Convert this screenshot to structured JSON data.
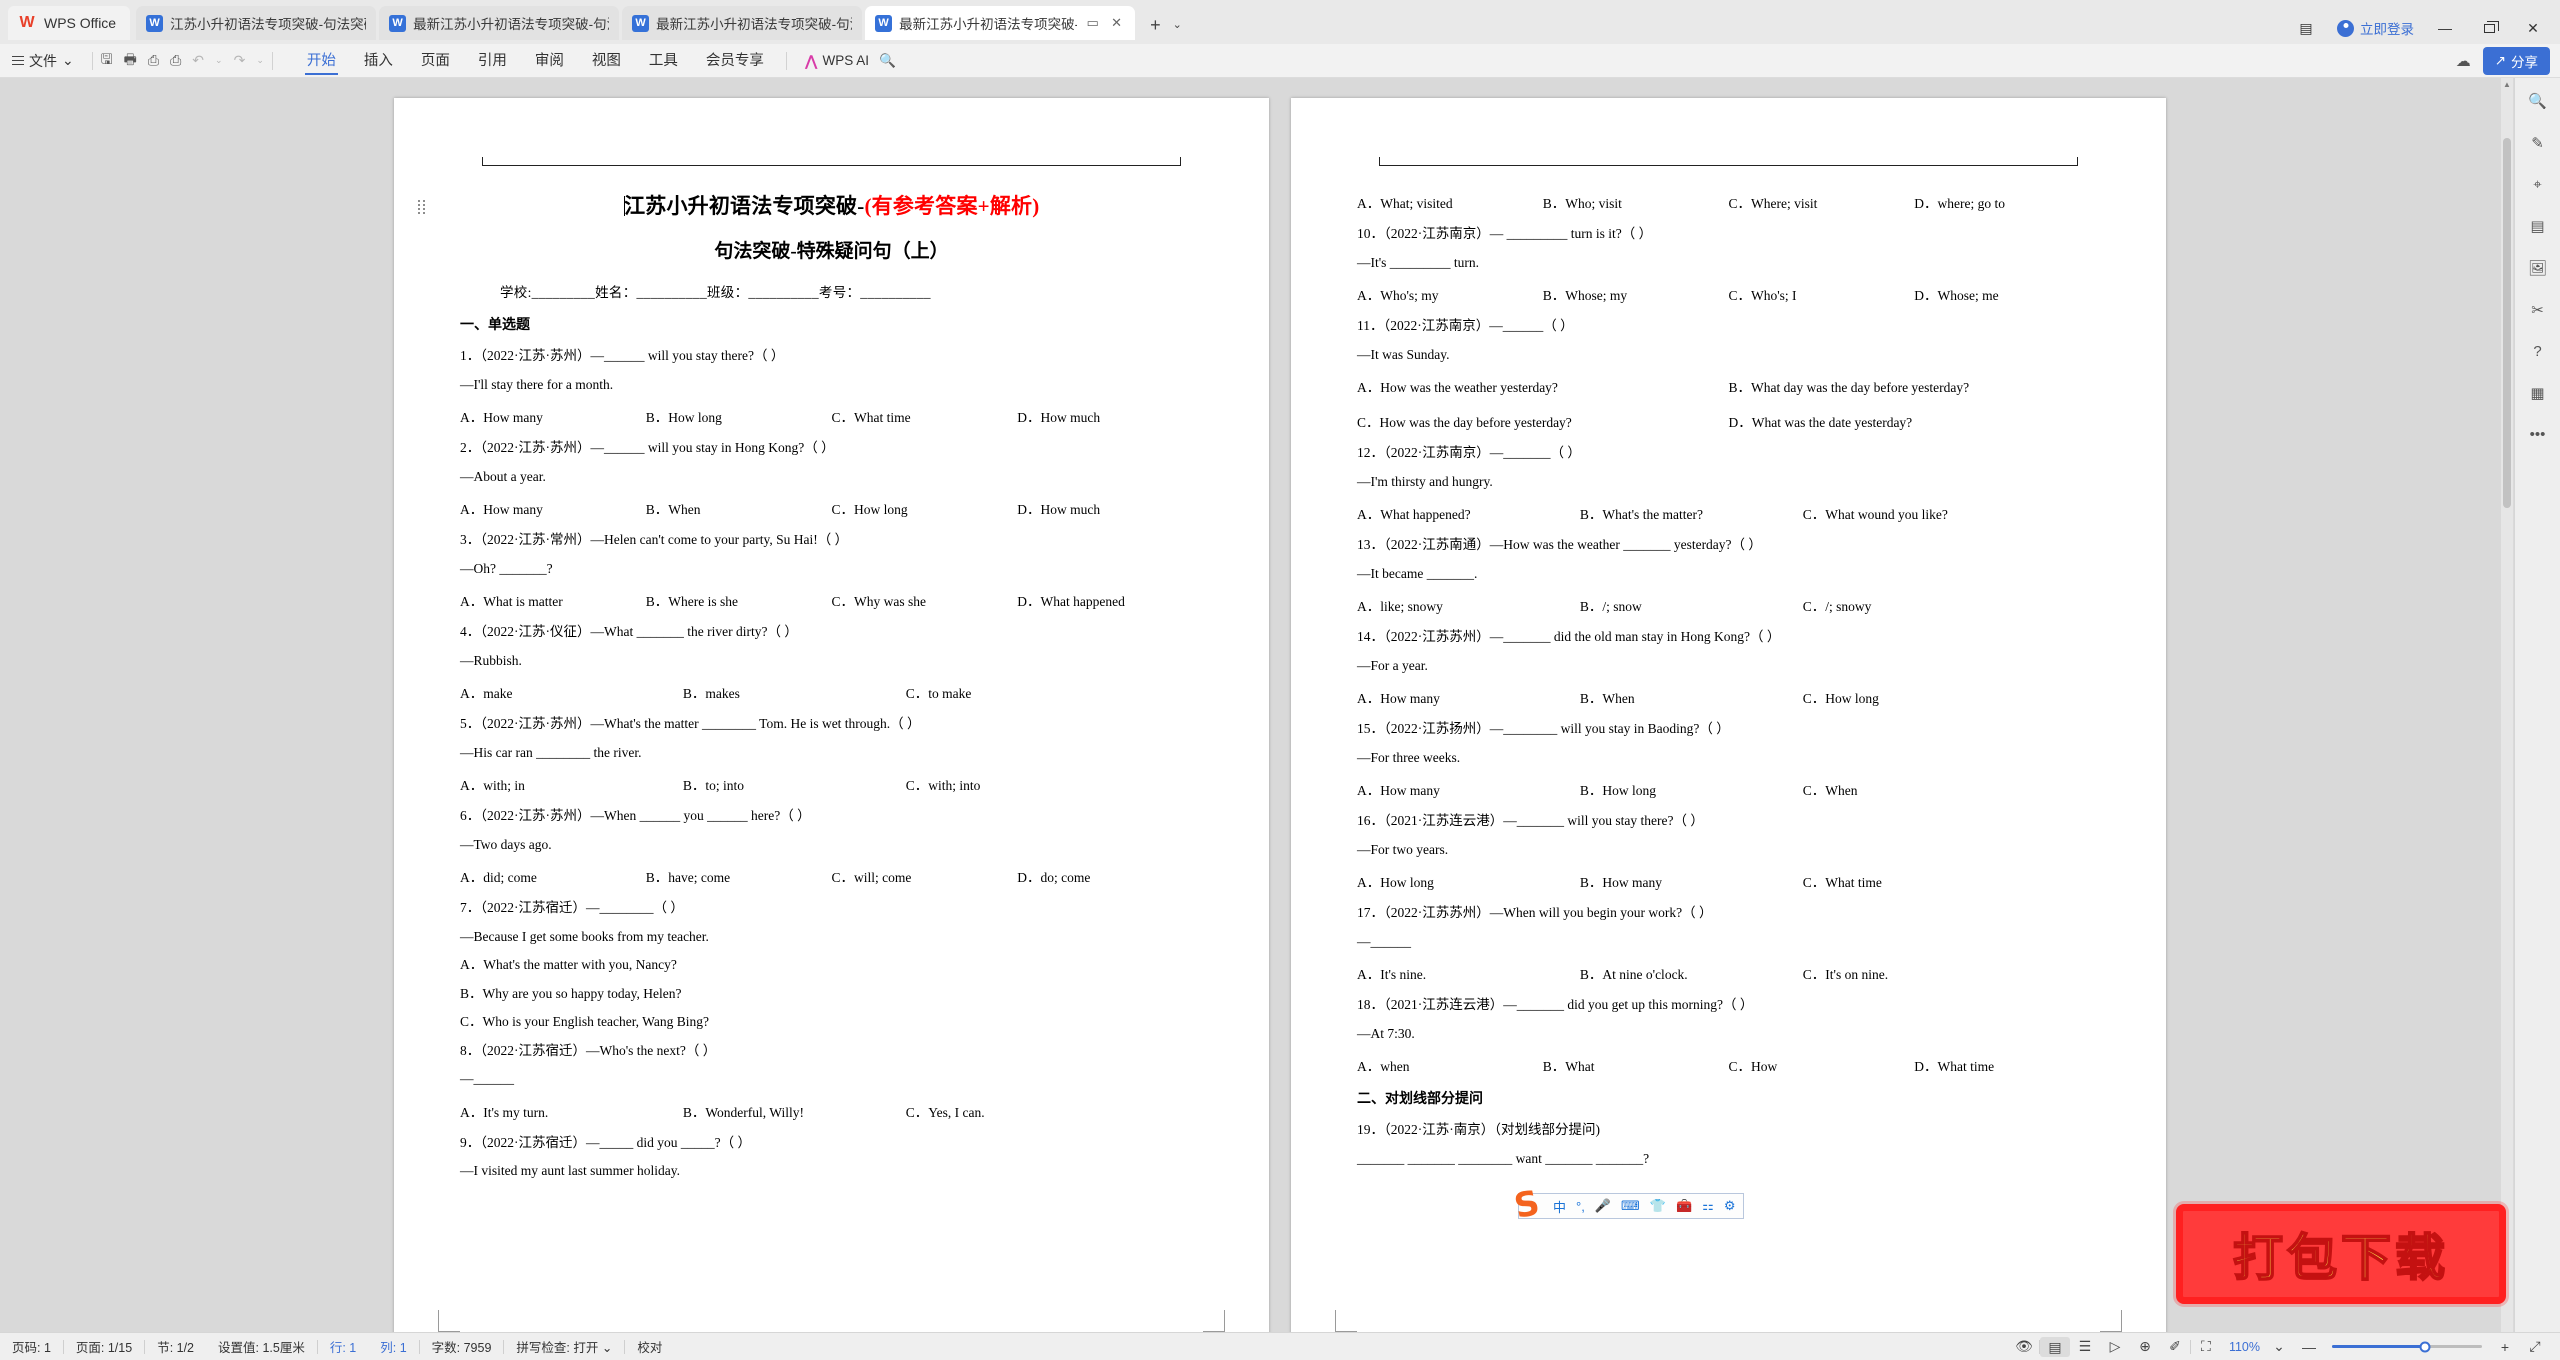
{
  "titlebar": {
    "app_name": "WPS Office",
    "app_logo": "wps-logo-icon",
    "tabs": [
      {
        "label": "江苏小升初语法专项突破-句法突破-T",
        "active": false
      },
      {
        "label": "最新江苏小升初语法专项突破-句法突",
        "active": false
      },
      {
        "label": "最新江苏小升初语法专项突破-句法突",
        "active": false
      },
      {
        "label": "最新江苏小升初语法专项突破-",
        "active": true
      }
    ],
    "new_tab": "+",
    "tab_dropdown": "⌄",
    "login_label": "立即登录",
    "minimize": "—",
    "restore": "restore-icon",
    "close": "✕",
    "side_panel": "side-panel-icon"
  },
  "ribbon": {
    "file_label": "文件",
    "file_caret": "⌄",
    "quick_access": [
      "save-icon",
      "print-preview-icon",
      "print-icon",
      "find-icon",
      "undo-icon",
      "undo-caret",
      "redo-icon",
      "redo-caret"
    ],
    "menus": [
      {
        "label": "开始",
        "active": true
      },
      {
        "label": "插入",
        "active": false
      },
      {
        "label": "页面",
        "active": false
      },
      {
        "label": "引用",
        "active": false
      },
      {
        "label": "审阅",
        "active": false
      },
      {
        "label": "视图",
        "active": false
      },
      {
        "label": "工具",
        "active": false
      },
      {
        "label": "会员专享",
        "active": false
      }
    ],
    "wps_ai": "WPS AI",
    "search": "🔍",
    "cloud": "cloud-icon",
    "share_label": "分享",
    "share_color": "#3b6fd4"
  },
  "document": {
    "title_black": "江苏小升初语法专项突破-",
    "title_red": "(有参考答案+解析)",
    "subtitle": "句法突破-特殊疑问句（上）",
    "meta": "学校:_________姓名：__________班级：__________考号：__________",
    "section1": "一、单选题",
    "section2": "二、对划线部分提问",
    "left_page": [
      {
        "type": "q",
        "text": "1．（2022·江苏·苏州）—______ will you stay there?（   ）"
      },
      {
        "type": "q",
        "text": "—I'll stay there for a month."
      },
      {
        "type": "opts",
        "items": [
          "A．How many",
          "B．How long",
          "C．What time",
          "D．How much"
        ]
      },
      {
        "type": "q",
        "text": "2．（2022·江苏·苏州）—______ will you stay in Hong Kong?（   ）"
      },
      {
        "type": "q",
        "text": "—About a year."
      },
      {
        "type": "opts",
        "items": [
          "A．How many",
          "B．When",
          "C．How long",
          "D．How much"
        ]
      },
      {
        "type": "q",
        "text": "3．（2022·江苏·常州）—Helen can't come to your party, Su Hai!（   ）"
      },
      {
        "type": "q",
        "text": "—Oh? _______?"
      },
      {
        "type": "opts",
        "items": [
          "A．What is matter",
          "B．Where is she",
          "C．Why was she",
          "D．What happened"
        ]
      },
      {
        "type": "q",
        "text": "4．（2022·江苏·仪征）—What _______ the river dirty?（  ）"
      },
      {
        "type": "q",
        "text": "—Rubbish."
      },
      {
        "type": "opts",
        "items": [
          "A．make",
          "B．makes",
          "C．to make"
        ]
      },
      {
        "type": "q",
        "text": "5．（2022·江苏·苏州）—What's the matter ________ Tom. He is wet through.（    ）"
      },
      {
        "type": "q",
        "text": "—His car ran ________ the river."
      },
      {
        "type": "opts",
        "items": [
          "A．with; in",
          "B．to; into",
          "C．with; into"
        ]
      },
      {
        "type": "q",
        "text": "6．（2022·江苏·苏州）—When ______ you ______ here?（   ）"
      },
      {
        "type": "q",
        "text": "—Two days ago."
      },
      {
        "type": "opts",
        "items": [
          "A．did; come",
          "B．have; come",
          "C．will; come",
          "D．do; come"
        ]
      },
      {
        "type": "q",
        "text": "7．（2022·江苏宿迁）—________（  ）"
      },
      {
        "type": "q",
        "text": "—Because I get some books from my teacher."
      },
      {
        "type": "q",
        "text": "A．What's the matter with you, Nancy?"
      },
      {
        "type": "q",
        "text": "B．Why are you so happy today, Helen?"
      },
      {
        "type": "q",
        "text": "C．Who is your English teacher, Wang Bing?"
      },
      {
        "type": "q",
        "text": "8．（2022·江苏宿迁）—Who's the next?（   ）"
      },
      {
        "type": "q",
        "text": "—______"
      },
      {
        "type": "opts",
        "items": [
          "A．It's my turn.",
          "B．Wonderful, Willy!",
          "C．Yes, I can."
        ]
      },
      {
        "type": "q",
        "text": "9．（2022·江苏宿迁）—_____ did you _____?（   ）"
      },
      {
        "type": "q",
        "text": "—I visited my aunt last summer holiday."
      }
    ],
    "right_page": [
      {
        "type": "opts",
        "items": [
          "A．What; visited",
          "B．Who; visit",
          "C．Where; visit",
          "D．where; go to"
        ]
      },
      {
        "type": "q",
        "text": "10．（2022·江苏南京）— _________ turn is it?（    ）"
      },
      {
        "type": "q",
        "text": "—It's _________ turn."
      },
      {
        "type": "opts",
        "items": [
          "A．Who's; my",
          "B．Whose; my",
          "C．Who's; I",
          "D．Whose; me"
        ]
      },
      {
        "type": "q",
        "text": "11．（2022·江苏南京）—______（  ）"
      },
      {
        "type": "q",
        "text": "—It was Sunday."
      },
      {
        "type": "opts2",
        "items": [
          "A．How was the weather yesterday?",
          "B．What day was the day before yesterday?"
        ]
      },
      {
        "type": "opts2",
        "items": [
          "C．How was the day before yesterday?",
          "D．What was the date yesterday?"
        ]
      },
      {
        "type": "q",
        "text": "12．（2022·江苏南京）—_______（  ）"
      },
      {
        "type": "q",
        "text": "—I'm thirsty and hungry."
      },
      {
        "type": "opts",
        "items": [
          "A．What happened?",
          "B．What's the matter?",
          "C．What wound you like?"
        ]
      },
      {
        "type": "q",
        "text": "13．（2022·江苏南通）—How was the weather _______ yesterday?（  ）"
      },
      {
        "type": "q",
        "text": "—It became _______."
      },
      {
        "type": "opts",
        "items": [
          "A．like; snowy",
          "B．/; snow",
          "C．/; snowy"
        ]
      },
      {
        "type": "q",
        "text": "14．（2022·江苏苏州）—_______ did the old man stay in Hong Kong?（   ）"
      },
      {
        "type": "q",
        "text": "—For a year."
      },
      {
        "type": "opts",
        "items": [
          "A．How many",
          "B．When",
          "C．How long"
        ]
      },
      {
        "type": "q",
        "text": "15．（2022·江苏扬州）—________ will you stay in Baoding?（   ）"
      },
      {
        "type": "q",
        "text": "—For three weeks."
      },
      {
        "type": "opts",
        "items": [
          "A．How many",
          "B．How long",
          "C．When"
        ]
      },
      {
        "type": "q",
        "text": "16．（2021·江苏连云港）—_______ will you stay there?（   ）"
      },
      {
        "type": "q",
        "text": "—For two years."
      },
      {
        "type": "opts",
        "items": [
          "A．How long",
          "B．How many",
          "C．What time"
        ]
      },
      {
        "type": "q",
        "text": "17．（2022·江苏苏州）—When will you begin your work?（   ）"
      },
      {
        "type": "q",
        "text": "—______"
      },
      {
        "type": "opts",
        "items": [
          "A．It's nine.",
          "B．At nine o'clock.",
          "C．It's on nine."
        ]
      },
      {
        "type": "q",
        "text": "18．（2021·江苏连云港）—_______ did you get up this morning?（  ）"
      },
      {
        "type": "q",
        "text": "—At 7:30."
      },
      {
        "type": "opts",
        "items": [
          "A．when",
          "B．What",
          "C．How",
          "D．What time"
        ]
      },
      {
        "type": "q",
        "text": "19．（2022·江苏·南京）（对划线部分提问)"
      },
      {
        "type": "q",
        "text": "_______ _______ ________ want _______ _______?"
      }
    ]
  },
  "ime": {
    "logo": "sogou-logo-icon",
    "items": [
      "中",
      "°,",
      "mic-icon",
      "keyboard-icon",
      "skin-icon",
      "toolbox-icon",
      "apps-icon",
      "settings-icon"
    ]
  },
  "rail": {
    "items": [
      "search-icon",
      "pen-icon",
      "cursor-icon",
      "layout-icon",
      "image-icon",
      "shapes-icon",
      "help-icon",
      "chart-icon",
      "more-icon"
    ]
  },
  "statusbar": {
    "left": [
      "页码: 1",
      "页面: 1/15",
      "节: 1/2",
      "设置值: 1.5厘米",
      "行: 1",
      "列: 1",
      "字数: 7959",
      "拼写检查: 打开",
      "校对"
    ],
    "view_icons": [
      "eye-icon",
      "print-layout-icon",
      "outline-icon",
      "web-layout-icon",
      "globe-icon",
      "highlighter-icon",
      "focus-icon"
    ],
    "zoom_label": "110%",
    "zoom_caret": "⌄",
    "zoom_minus": "—",
    "zoom_plus": "+",
    "fullscreen": "fullscreen-icon"
  },
  "watermark": {
    "label": "打包下载",
    "bg": "#ff3b3b",
    "text_color": "#ffe94d"
  }
}
